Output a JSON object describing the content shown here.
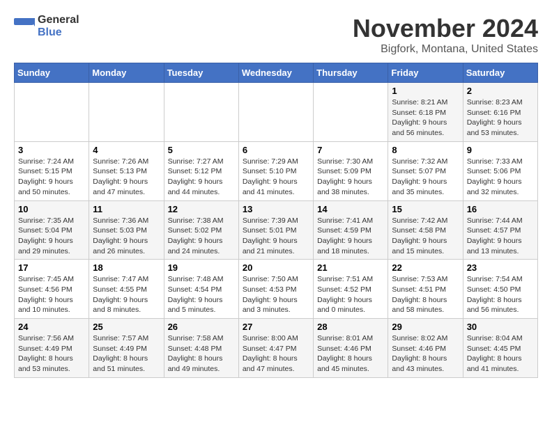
{
  "header": {
    "logo_general": "General",
    "logo_blue": "Blue",
    "title": "November 2024",
    "subtitle": "Bigfork, Montana, United States"
  },
  "days_of_week": [
    "Sunday",
    "Monday",
    "Tuesday",
    "Wednesday",
    "Thursday",
    "Friday",
    "Saturday"
  ],
  "weeks": [
    [
      {
        "day": "",
        "info": ""
      },
      {
        "day": "",
        "info": ""
      },
      {
        "day": "",
        "info": ""
      },
      {
        "day": "",
        "info": ""
      },
      {
        "day": "",
        "info": ""
      },
      {
        "day": "1",
        "info": "Sunrise: 8:21 AM\nSunset: 6:18 PM\nDaylight: 9 hours and 56 minutes."
      },
      {
        "day": "2",
        "info": "Sunrise: 8:23 AM\nSunset: 6:16 PM\nDaylight: 9 hours and 53 minutes."
      }
    ],
    [
      {
        "day": "3",
        "info": "Sunrise: 7:24 AM\nSunset: 5:15 PM\nDaylight: 9 hours and 50 minutes."
      },
      {
        "day": "4",
        "info": "Sunrise: 7:26 AM\nSunset: 5:13 PM\nDaylight: 9 hours and 47 minutes."
      },
      {
        "day": "5",
        "info": "Sunrise: 7:27 AM\nSunset: 5:12 PM\nDaylight: 9 hours and 44 minutes."
      },
      {
        "day": "6",
        "info": "Sunrise: 7:29 AM\nSunset: 5:10 PM\nDaylight: 9 hours and 41 minutes."
      },
      {
        "day": "7",
        "info": "Sunrise: 7:30 AM\nSunset: 5:09 PM\nDaylight: 9 hours and 38 minutes."
      },
      {
        "day": "8",
        "info": "Sunrise: 7:32 AM\nSunset: 5:07 PM\nDaylight: 9 hours and 35 minutes."
      },
      {
        "day": "9",
        "info": "Sunrise: 7:33 AM\nSunset: 5:06 PM\nDaylight: 9 hours and 32 minutes."
      }
    ],
    [
      {
        "day": "10",
        "info": "Sunrise: 7:35 AM\nSunset: 5:04 PM\nDaylight: 9 hours and 29 minutes."
      },
      {
        "day": "11",
        "info": "Sunrise: 7:36 AM\nSunset: 5:03 PM\nDaylight: 9 hours and 26 minutes."
      },
      {
        "day": "12",
        "info": "Sunrise: 7:38 AM\nSunset: 5:02 PM\nDaylight: 9 hours and 24 minutes."
      },
      {
        "day": "13",
        "info": "Sunrise: 7:39 AM\nSunset: 5:01 PM\nDaylight: 9 hours and 21 minutes."
      },
      {
        "day": "14",
        "info": "Sunrise: 7:41 AM\nSunset: 4:59 PM\nDaylight: 9 hours and 18 minutes."
      },
      {
        "day": "15",
        "info": "Sunrise: 7:42 AM\nSunset: 4:58 PM\nDaylight: 9 hours and 15 minutes."
      },
      {
        "day": "16",
        "info": "Sunrise: 7:44 AM\nSunset: 4:57 PM\nDaylight: 9 hours and 13 minutes."
      }
    ],
    [
      {
        "day": "17",
        "info": "Sunrise: 7:45 AM\nSunset: 4:56 PM\nDaylight: 9 hours and 10 minutes."
      },
      {
        "day": "18",
        "info": "Sunrise: 7:47 AM\nSunset: 4:55 PM\nDaylight: 9 hours and 8 minutes."
      },
      {
        "day": "19",
        "info": "Sunrise: 7:48 AM\nSunset: 4:54 PM\nDaylight: 9 hours and 5 minutes."
      },
      {
        "day": "20",
        "info": "Sunrise: 7:50 AM\nSunset: 4:53 PM\nDaylight: 9 hours and 3 minutes."
      },
      {
        "day": "21",
        "info": "Sunrise: 7:51 AM\nSunset: 4:52 PM\nDaylight: 9 hours and 0 minutes."
      },
      {
        "day": "22",
        "info": "Sunrise: 7:53 AM\nSunset: 4:51 PM\nDaylight: 8 hours and 58 minutes."
      },
      {
        "day": "23",
        "info": "Sunrise: 7:54 AM\nSunset: 4:50 PM\nDaylight: 8 hours and 56 minutes."
      }
    ],
    [
      {
        "day": "24",
        "info": "Sunrise: 7:56 AM\nSunset: 4:49 PM\nDaylight: 8 hours and 53 minutes."
      },
      {
        "day": "25",
        "info": "Sunrise: 7:57 AM\nSunset: 4:49 PM\nDaylight: 8 hours and 51 minutes."
      },
      {
        "day": "26",
        "info": "Sunrise: 7:58 AM\nSunset: 4:48 PM\nDaylight: 8 hours and 49 minutes."
      },
      {
        "day": "27",
        "info": "Sunrise: 8:00 AM\nSunset: 4:47 PM\nDaylight: 8 hours and 47 minutes."
      },
      {
        "day": "28",
        "info": "Sunrise: 8:01 AM\nSunset: 4:46 PM\nDaylight: 8 hours and 45 minutes."
      },
      {
        "day": "29",
        "info": "Sunrise: 8:02 AM\nSunset: 4:46 PM\nDaylight: 8 hours and 43 minutes."
      },
      {
        "day": "30",
        "info": "Sunrise: 8:04 AM\nSunset: 4:45 PM\nDaylight: 8 hours and 41 minutes."
      }
    ]
  ]
}
